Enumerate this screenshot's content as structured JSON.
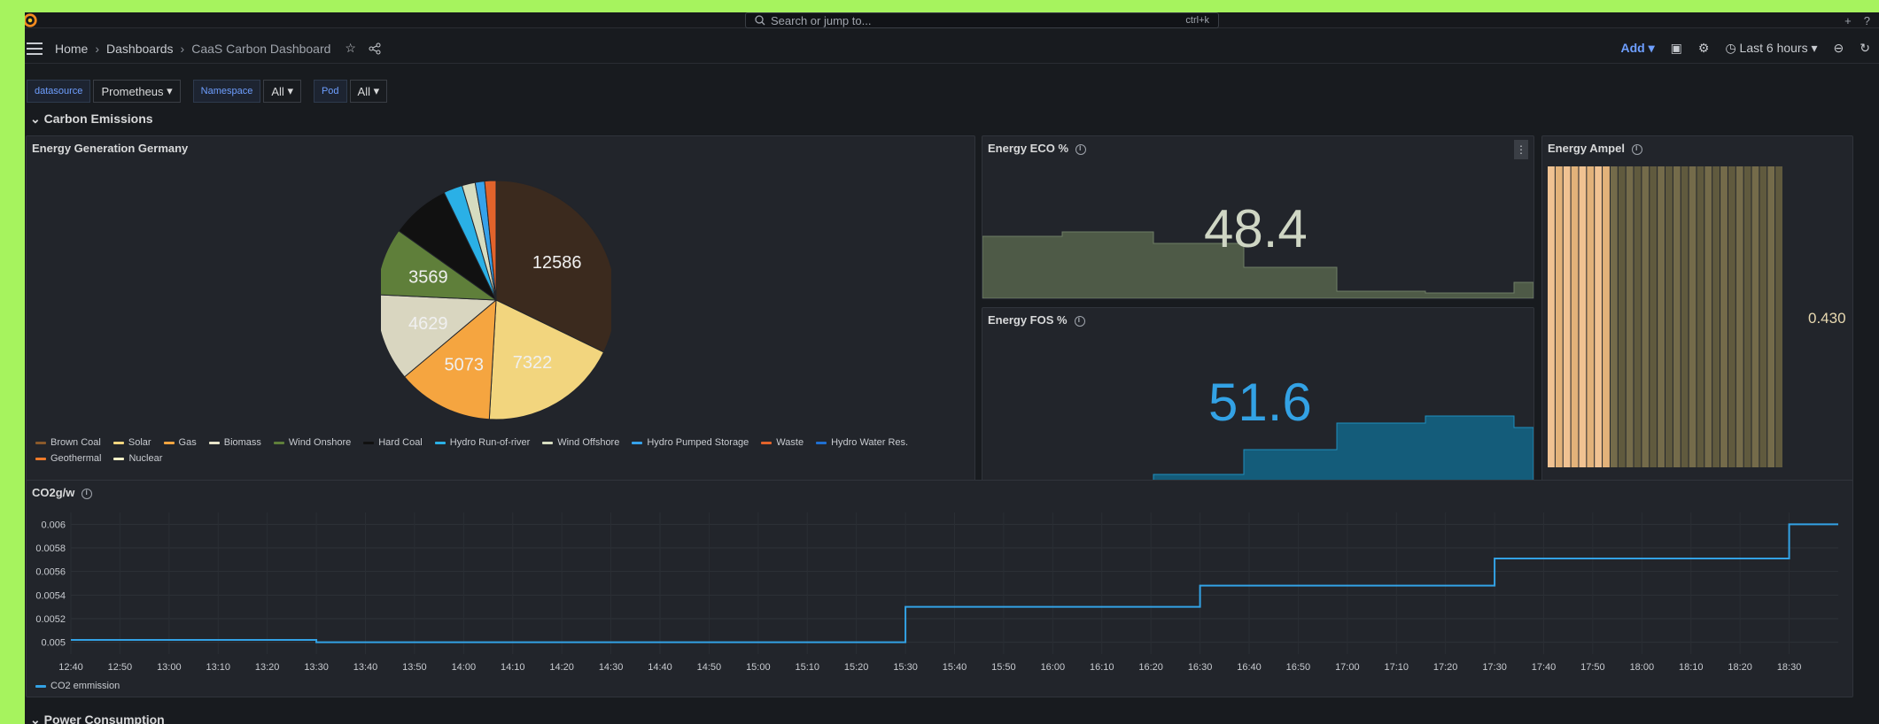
{
  "topbar": {
    "search_placeholder": "Search or jump to...",
    "search_shortcut": "ctrl+k",
    "plus_label": "+",
    "help_label": "?"
  },
  "breadcrumb": {
    "home": "Home",
    "dashboards": "Dashboards",
    "current": "CaaS Carbon Dashboard"
  },
  "toolbar": {
    "add_label": "Add",
    "time_range": "Last 6 hours"
  },
  "variables": [
    {
      "label": "datasource",
      "value": "Prometheus"
    },
    {
      "label": "Namespace",
      "value": "All"
    },
    {
      "label": "Pod",
      "value": "All"
    }
  ],
  "rows": {
    "carbon": "Carbon Emissions",
    "power": "Power Consumption"
  },
  "panels": {
    "energy_generation": {
      "title": "Energy Generation Germany"
    },
    "eco": {
      "title": "Energy ECO %",
      "value": "48.4"
    },
    "fos": {
      "title": "Energy FOS %",
      "value": "51.6"
    },
    "ampel": {
      "title": "Energy Ampel",
      "value": "0.430"
    },
    "co2": {
      "title": "CO2g/w",
      "legend": "CO2 emmission"
    }
  },
  "pie_legend": [
    {
      "name": "Brown Coal",
      "color": "#8a5a2b"
    },
    {
      "name": "Solar",
      "color": "#f2d57e"
    },
    {
      "name": "Gas",
      "color": "#f5a540"
    },
    {
      "name": "Biomass",
      "color": "#e6e3c8"
    },
    {
      "name": "Wind Onshore",
      "color": "#5f7f3a"
    },
    {
      "name": "Hard Coal",
      "color": "#111111"
    },
    {
      "name": "Hydro Run-of-river",
      "color": "#2ab0e6"
    },
    {
      "name": "Wind Offshore",
      "color": "#d6dcc0"
    },
    {
      "name": "Hydro Pumped Storage",
      "color": "#36a2eb"
    },
    {
      "name": "Waste",
      "color": "#e2632b"
    },
    {
      "name": "Hydro Water Res.",
      "color": "#1f6fd1"
    },
    {
      "name": "Geothermal",
      "color": "#ef7a2a"
    },
    {
      "name": "Nuclear",
      "color": "#f5f1c8"
    }
  ],
  "chart_data": [
    {
      "type": "pie",
      "title": "Energy Generation Germany",
      "slices": [
        {
          "label": "Brown Coal",
          "value": 12586,
          "color": "#3b2a1e"
        },
        {
          "label": "Solar",
          "value": 7322,
          "color": "#f2d57e"
        },
        {
          "label": "Gas",
          "value": 5073,
          "color": "#f5a540"
        },
        {
          "label": "Biomass",
          "value": 4629,
          "color": "#d9d6c0"
        },
        {
          "label": "Wind Onshore",
          "value": 3569,
          "color": "#5f7f3a"
        },
        {
          "label": "Hard Coal",
          "value": 3127,
          "color": "#111111"
        },
        {
          "label": "Hydro Run-of-river",
          "value": 1000,
          "color": "#2ab0e6"
        },
        {
          "label": "Wind Offshore",
          "value": 700,
          "color": "#d6dcc0"
        },
        {
          "label": "Hydro Pumped Storage",
          "value": 500,
          "color": "#36a2eb"
        },
        {
          "label": "Waste",
          "value": 600,
          "color": "#e2632b"
        }
      ]
    },
    {
      "type": "line",
      "title": "CO2g/w",
      "series": [
        {
          "name": "CO2 emmission",
          "x": [
            "12:40",
            "13:30",
            "15:30",
            "16:30",
            "17:30",
            "18:30",
            "18:40"
          ],
          "values": [
            0.00502,
            0.005,
            0.0053,
            0.00548,
            0.00571,
            0.006,
            0.006
          ]
        }
      ],
      "ylim": [
        0.0049,
        0.0061
      ],
      "yticks": [
        "0.006",
        "0.0058",
        "0.0056",
        "0.0054",
        "0.0052",
        "0.005"
      ],
      "xticks": [
        "12:40",
        "12:50",
        "13:00",
        "13:10",
        "13:20",
        "13:30",
        "13:40",
        "13:50",
        "14:00",
        "14:10",
        "14:20",
        "14:30",
        "14:40",
        "14:50",
        "15:00",
        "15:10",
        "15:20",
        "15:30",
        "15:40",
        "15:50",
        "16:00",
        "16:10",
        "16:20",
        "16:30",
        "16:40",
        "16:50",
        "17:00",
        "17:10",
        "17:20",
        "17:30",
        "17:40",
        "17:50",
        "18:00",
        "18:10",
        "18:20",
        "18:30"
      ]
    }
  ]
}
